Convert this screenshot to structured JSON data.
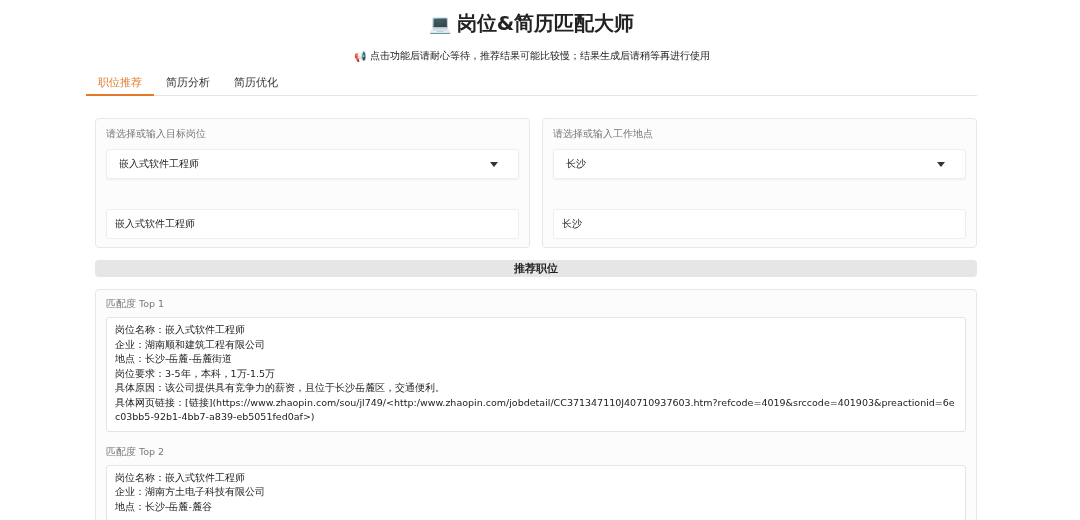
{
  "header": {
    "icon": "💻",
    "title": "岗位&简历匹配大师",
    "notice_icon": "📢",
    "notice": "点击功能后请耐心等待，推荐结果可能比较慢；结果生成后请稍等再进行使用"
  },
  "tabs": [
    {
      "label": "职位推荐",
      "selected": true
    },
    {
      "label": "简历分析",
      "selected": false
    },
    {
      "label": "简历优化",
      "selected": false
    }
  ],
  "inputs": [
    {
      "label": "请选择或输入目标岗位",
      "dropdown_value": "嵌入式软件工程师",
      "text_value": "嵌入式软件工程师"
    },
    {
      "label": "请选择或输入工作地点",
      "dropdown_value": "长沙",
      "text_value": "长沙"
    }
  ],
  "submit_button": "推荐职位",
  "results": [
    {
      "label": "匹配度 Top 1",
      "lines": [
        "岗位名称：嵌入式软件工程师",
        "企业：湖南顺和建筑工程有限公司",
        "地点：长沙-岳麓-岳麓街道",
        "岗位要求：3-5年，本科，1万-1.5万",
        "具体原因：该公司提供具有竞争力的薪资，且位于长沙岳麓区，交通便利。",
        "具体网页链接：[链接](https://www.zhaopin.com/sou/jl749/<http:/www.zhaopin.com/jobdetail/CC371347110J40710937603.htm?refcode=4019&srccode=401903&preactionid=6ec03bb5-92b1-4bb7-a839-eb5051fed0af>)"
      ]
    },
    {
      "label": "匹配度 Top 2",
      "lines": [
        "岗位名称：嵌入式软件工程师",
        "企业：湖南方土电子科技有限公司",
        "地点：长沙-岳麓-麓谷"
      ]
    }
  ]
}
